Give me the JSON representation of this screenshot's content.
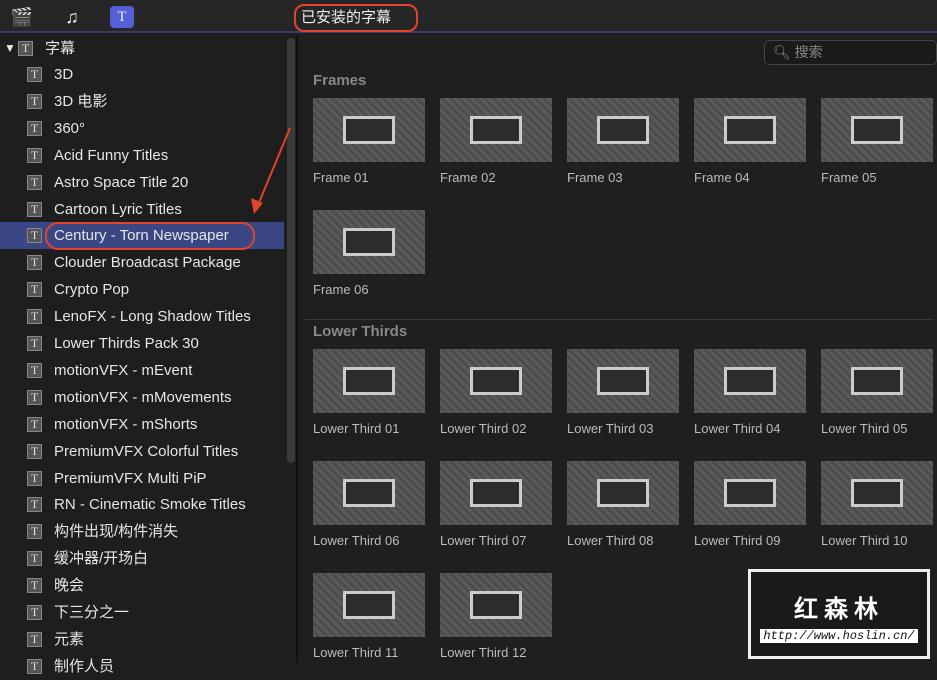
{
  "toolbar": {
    "icons": [
      "clapper-star-icon",
      "music-photo-icon",
      "titles-icon"
    ],
    "dropdown": "已安装的字幕 ⌃⌄"
  },
  "sidebar": {
    "root": "字幕",
    "items": [
      "3D",
      "3D 电影",
      "360°",
      "Acid Funny Titles",
      "Astro Space Title 20",
      "Cartoon Lyric Titles",
      "Century - Torn Newspaper",
      "Clouder Broadcast Package",
      "Crypto Pop",
      "LenoFX - Long Shadow Titles",
      "Lower Thirds Pack 30",
      "motionVFX - mEvent",
      "motionVFX - mMovements",
      "motionVFX - mShorts",
      "PremiumVFX Colorful Titles",
      "PremiumVFX Multi PiP",
      "RN - Cinematic Smoke Titles",
      "构件出现/构件消失",
      "缓冲器/开场白",
      "晚会",
      "下三分之一",
      "元素",
      "制作人员"
    ],
    "selected": "Century - Torn Newspaper"
  },
  "search": {
    "placeholder": "搜索"
  },
  "sections": [
    {
      "title": "Frames",
      "items": [
        "Frame 01",
        "Frame 02",
        "Frame 03",
        "Frame 04",
        "Frame 05",
        "Frame 06"
      ]
    },
    {
      "title": "Lower Thirds",
      "items": [
        "Lower Third 01",
        "Lower Third 02",
        "Lower Third 03",
        "Lower Third 04",
        "Lower Third 05",
        "Lower Third 06",
        "Lower Third 07",
        "Lower Third 08",
        "Lower Third 09",
        "Lower Third 10",
        "Lower Third 11",
        "Lower Third 12"
      ]
    }
  ],
  "watermark": {
    "name": "红森林",
    "url": "http://www.hoslin.cn/"
  },
  "colors": {
    "selection": "#3b4785",
    "annotation": "#e0442c"
  }
}
